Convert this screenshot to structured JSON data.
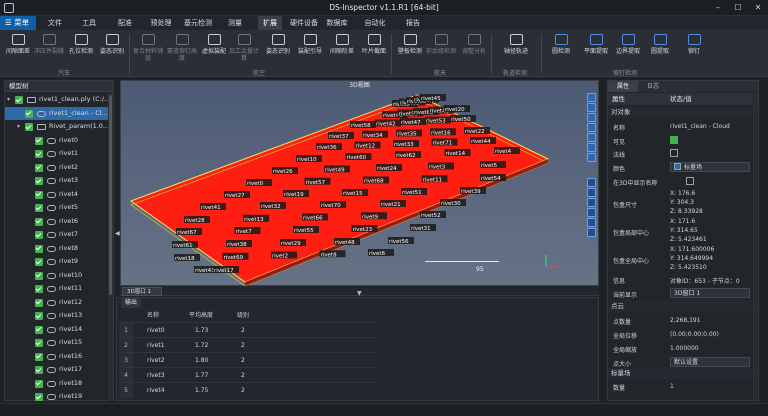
{
  "window": {
    "title": "DS-Inspector v1.1.R1 [64-bit]"
  },
  "menu": {
    "home": "☰ 菜单",
    "items": [
      "文件",
      "工具",
      "配准",
      "预处理",
      "基元检测",
      "测量",
      "扩展",
      "硬件设备",
      "数据库",
      "自动化",
      "报告"
    ],
    "active_index": 6
  },
  "ribbon": {
    "groups": [
      {
        "label": "汽车",
        "tools": [
          "间隙面差",
          "冲压件裂缝",
          "孔位检测",
          "姿态识别"
        ]
      },
      {
        "label": "航空",
        "tools": [
          "复合材料铺层",
          "蒙皮铆钉高度",
          "虚拟装配",
          "加工余量计算",
          "姿态识别",
          "装配引导",
          "间隙阶差",
          "叶片截面"
        ]
      },
      {
        "label": "航天",
        "tools": [
          "壁板检测",
          "前后缘检测",
          "调整分析"
        ]
      },
      {
        "label": "轨道检测",
        "tools": [
          "轴径轨迹"
        ]
      },
      {
        "label": "铆钉检测",
        "tools": [
          "圆检测",
          "平面提取",
          "边界提取",
          "圆提取",
          "铆钉"
        ]
      }
    ]
  },
  "model_tree": {
    "title": "模型树",
    "items": [
      {
        "label": "rivet1_clean.ply (C:/...",
        "level": 0,
        "type": "folder",
        "checked": true,
        "expanded": true
      },
      {
        "label": "rivet1_clean - Cl...",
        "level": 1,
        "type": "cloud",
        "checked": true,
        "selected": true
      },
      {
        "label": "Rivet_param(1.0...",
        "level": 1,
        "type": "folder",
        "checked": true,
        "expanded": true
      },
      {
        "label": "rivet0",
        "level": 2,
        "type": "cloud",
        "checked": true
      },
      {
        "label": "rivet1",
        "level": 2,
        "type": "cloud",
        "checked": true
      },
      {
        "label": "rivet2",
        "level": 2,
        "type": "cloud",
        "checked": true
      },
      {
        "label": "rivet3",
        "level": 2,
        "type": "cloud",
        "checked": true
      },
      {
        "label": "rivet4",
        "level": 2,
        "type": "cloud",
        "checked": true
      },
      {
        "label": "rivet5",
        "level": 2,
        "type": "cloud",
        "checked": true
      },
      {
        "label": "rivet6",
        "level": 2,
        "type": "cloud",
        "checked": true
      },
      {
        "label": "rivet7",
        "level": 2,
        "type": "cloud",
        "checked": true
      },
      {
        "label": "rivet8",
        "level": 2,
        "type": "cloud",
        "checked": true
      },
      {
        "label": "rivet9",
        "level": 2,
        "type": "cloud",
        "checked": true
      },
      {
        "label": "rivet10",
        "level": 2,
        "type": "cloud",
        "checked": true
      },
      {
        "label": "rivet11",
        "level": 2,
        "type": "cloud",
        "checked": true
      },
      {
        "label": "rivet12",
        "level": 2,
        "type": "cloud",
        "checked": true
      },
      {
        "label": "rivet13",
        "level": 2,
        "type": "cloud",
        "checked": true
      },
      {
        "label": "rivet14",
        "level": 2,
        "type": "cloud",
        "checked": true
      },
      {
        "label": "rivet15",
        "level": 2,
        "type": "cloud",
        "checked": true
      },
      {
        "label": "rivet16",
        "level": 2,
        "type": "cloud",
        "checked": true
      },
      {
        "label": "rivet17",
        "level": 2,
        "type": "cloud",
        "checked": true
      },
      {
        "label": "rivet18",
        "level": 2,
        "type": "cloud",
        "checked": true
      },
      {
        "label": "rivet19",
        "level": 2,
        "type": "cloud",
        "checked": true
      }
    ]
  },
  "viewport": {
    "title": "3D视图",
    "scale_value": "95",
    "tab_label": "3D窗口 1",
    "rivet_labels": [
      "rivet1",
      "rivet65",
      "rivet25",
      "rivet64",
      "rivet45",
      "rivet46",
      "rivet59",
      "rivet63",
      "rivet40",
      "rivet20",
      "rivet58",
      "rivet42",
      "rivet47",
      "rivet53",
      "rivet50",
      "rivet37",
      "rivet34",
      "rivet35",
      "rivet16",
      "rivet22",
      "rivet36",
      "rivet12",
      "rivet33",
      "rivet71",
      "rivet44",
      "rivet10",
      "rivet60",
      "rivet62",
      "rivet14",
      "rivet4",
      "rivet26",
      "rivet49",
      "rivet24",
      "rivet3",
      "rivet5",
      "rivet0",
      "rivet57",
      "rivet68",
      "rivet11",
      "rivet54",
      "rivet27",
      "rivet19",
      "rivet15",
      "rivet51",
      "rivet39",
      "rivet41",
      "rivet32",
      "rivet70",
      "rivet21",
      "rivet30",
      "rivet28",
      "rivet13",
      "rivet66",
      "rivet9",
      "rivet52",
      "rivet67",
      "rivet7",
      "rivet55",
      "rivet23",
      "rivet31",
      "rivet61",
      "rivet38",
      "rivet29",
      "rivet48",
      "rivet56",
      "rivet18",
      "rivet69",
      "rivet2",
      "rivet8",
      "rivet6",
      "rivet43",
      "rivet17"
    ]
  },
  "output": {
    "tab": "输出",
    "columns": [
      "名称",
      "平均高度",
      "级别"
    ],
    "rows": [
      {
        "num": "1",
        "name": "rivet0",
        "height": "1.73",
        "level": "2"
      },
      {
        "num": "2",
        "name": "rivet1",
        "height": "1.72",
        "level": "2"
      },
      {
        "num": "3",
        "name": "rivet2",
        "height": "1.80",
        "level": "2"
      },
      {
        "num": "4",
        "name": "rivet3",
        "height": "1.77",
        "level": "2"
      },
      {
        "num": "5",
        "name": "rivet4",
        "height": "1.75",
        "level": "2"
      }
    ]
  },
  "properties": {
    "tabs": [
      "属性",
      "日志"
    ],
    "header_key": "属性",
    "header_value": "状态/值",
    "sections": {
      "object": "对对象",
      "points": "点云",
      "scalar": "标量场"
    },
    "rows": {
      "name": {
        "k": "名称",
        "v": "rivet1_clean - Cloud"
      },
      "visible": {
        "k": "可见",
        "checked": true
      },
      "normal": {
        "k": "法线",
        "checked": false
      },
      "color": {
        "k": "颜色",
        "v": "标量场"
      },
      "show_name": {
        "k": "在3D中显示名称",
        "checked": false
      },
      "box_size": {
        "k": "包盒尺寸",
        "v": [
          "X: 176.6",
          "Y: 304.3",
          "Z: 8.33928"
        ]
      },
      "box_center": {
        "k": "包盒局部中心",
        "v": [
          "X: 171.6",
          "Y: 314.65",
          "Z: 5.423461"
        ]
      },
      "box_global": {
        "k": "包盒全局中心",
        "v": [
          "X: 171.600006",
          "Y: 314.649994",
          "Z: 5.423510"
        ]
      },
      "info": {
        "k": "信息",
        "v": "对象ID：653 - 子节点：0"
      },
      "display": {
        "k": "当前显示",
        "v": "3D窗口 1"
      },
      "point_count": {
        "k": "点数量",
        "v": "2,268,191"
      },
      "global_shift": {
        "k": "全局位移",
        "v": "(0.00;0.00;0.00)"
      },
      "global_scale": {
        "k": "全局缩放",
        "v": "1.000000"
      },
      "point_size": {
        "k": "点大小",
        "v": "默认设置"
      },
      "sf_count": {
        "k": "数量",
        "v": "1"
      }
    }
  }
}
